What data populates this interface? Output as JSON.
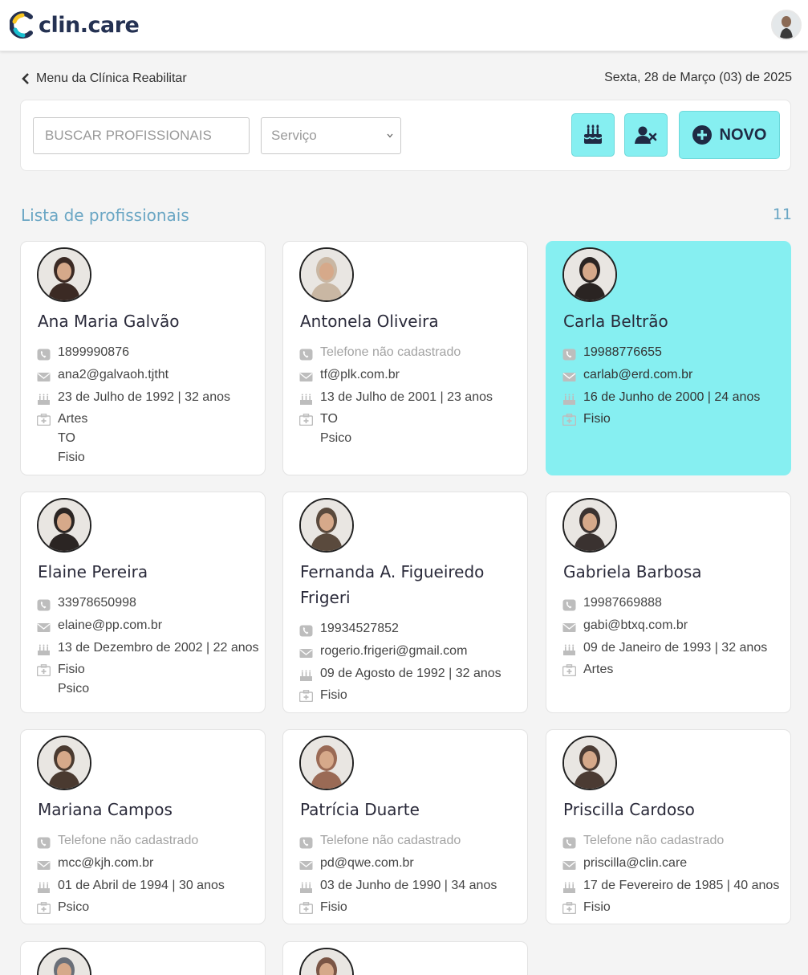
{
  "header": {
    "brand": "clin.care",
    "brand_colors": {
      "navy": "#243152",
      "yellow": "#f7c521",
      "teal": "#19bfd0"
    }
  },
  "subheader": {
    "back_label": "Menu da Clínica Reabilitar",
    "date": "Sexta, 28 de Março (03) de 2025"
  },
  "toolbar": {
    "search_placeholder": "BUSCAR PROFISSIONAIS",
    "service_placeholder": "Serviço",
    "birthday_icon": "birthday-cake-icon",
    "inactive_icon": "user-times-icon",
    "new_label": "NOVO"
  },
  "list": {
    "title": "Lista de profissionais",
    "count": "11"
  },
  "colors": {
    "accent": "#86eff1",
    "heading": "#6aa6c4"
  },
  "professionals": [
    {
      "name": "Ana Maria Galvão",
      "phone": "1899990876",
      "email": "ana2@galvaoh.tjtht",
      "birth": "23 de Julho de 1992 | 32 anos",
      "services": [
        "Artes",
        "TO",
        "Fisio"
      ]
    },
    {
      "name": "Antonela Oliveira",
      "phone": "Telefone não cadastrado",
      "email": "tf@plk.com.br",
      "birth": "13 de Julho de 2001 | 23 anos",
      "services": [
        "TO",
        "Psico"
      ]
    },
    {
      "name": "Carla Beltrão",
      "phone": "19988776655",
      "email": "carlab@erd.com.br",
      "birth": "16 de Junho de 2000 | 24 anos",
      "services": [
        "Fisio"
      ],
      "selected": true
    },
    {
      "name": "Elaine Pereira",
      "phone": "33978650998",
      "email": "elaine@pp.com.br",
      "birth": "13 de Dezembro de 2002 | 22 anos",
      "services": [
        "Fisio",
        "Psico"
      ]
    },
    {
      "name": "Fernanda A. Figueiredo Frigeri",
      "phone": "19934527852",
      "email": "rogerio.frigeri@gmail.com",
      "birth": "09 de Agosto de 1992 | 32 anos",
      "services": [
        "Fisio"
      ]
    },
    {
      "name": "Gabriela Barbosa",
      "phone": "19987669888",
      "email": "gabi@btxq.com.br",
      "birth": "09 de Janeiro de 1993 | 32 anos",
      "services": [
        "Artes"
      ]
    },
    {
      "name": "Mariana Campos",
      "phone": "Telefone não cadastrado",
      "email": "mcc@kjh.com.br",
      "birth": "01 de Abril de 1994 | 30 anos",
      "services": [
        "Psico"
      ]
    },
    {
      "name": "Patrícia Duarte",
      "phone": "Telefone não cadastrado",
      "email": "pd@qwe.com.br",
      "birth": "03 de Junho de 1990 | 34 anos",
      "services": [
        "Fisio"
      ]
    },
    {
      "name": "Priscilla Cardoso",
      "phone": "Telefone não cadastrado",
      "email": "priscilla@clin.care",
      "birth": "17 de Fevereiro de 1985 | 40 anos",
      "services": [
        "Fisio"
      ]
    },
    {
      "name": "",
      "phone": "",
      "email": "",
      "birth": "",
      "services": []
    },
    {
      "name": "",
      "phone": "",
      "email": "",
      "birth": "",
      "services": []
    }
  ]
}
